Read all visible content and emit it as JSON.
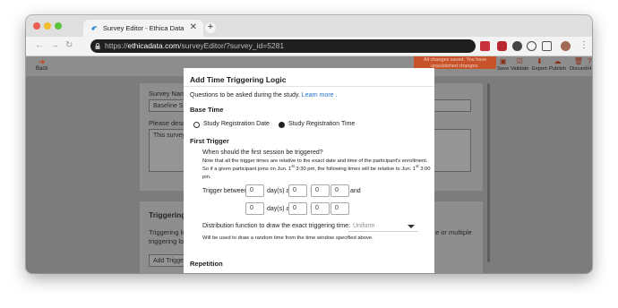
{
  "browser": {
    "tab_title": "Survey Editor - Ethica Data",
    "tab_close": "✕",
    "new_tab": "+",
    "url_prefix": "https://",
    "url_domain": "ethicadata.com",
    "url_path": "/surveyEditor/?survey_id=5281",
    "nav_back": "←",
    "nav_forward": "→",
    "nav_reload": "↻"
  },
  "toolbar": {
    "back_label": "Back",
    "notice_line1": "All changes saved. You have",
    "notice_line2": "unpublished changes.",
    "save_label": "Save",
    "validate_label": "Validate",
    "export_label": "Export",
    "publish_label": "Publish",
    "discard_label": "Discard",
    "help_label": "H"
  },
  "background": {
    "survey_name_label": "Survey Name",
    "survey_name_value": "Baseline S",
    "description_label": "Please descr",
    "description_value": "This survey",
    "triggering_title": "Triggering L",
    "triggering_text1": "Triggering lo",
    "triggering_text2": "triggering lo",
    "right_text": "e or multiple",
    "add_trigger_button": "Add Trigge"
  },
  "modal": {
    "title": "Add Time Triggering Logic",
    "intro_text": "Questions to be asked during the study.",
    "learn_more": "Learn more .",
    "base_time_heading": "Base Time",
    "option_registration_date": "Study Registration Date",
    "option_registration_time": "Study Registration Time",
    "first_trigger_heading": "First Trigger",
    "question": "When should the first session be triggered?",
    "note_line1": "Note that all the trigger times are relative to the exact date and time of the participant's enrollment.",
    "note_line2_a": "So if a given participant joins on Jun. 1",
    "note_sup": "st",
    "note_line2_b": " 3:30 pm, the following times will be relative to Jun. 1",
    "note_line2_c": " 3:00",
    "note_line3": "pm.",
    "trigger_between_label": "Trigger between",
    "days_at_label": "day(s) at",
    "and_label": "and",
    "colon": ":",
    "from": {
      "days": "0",
      "hours": "0",
      "minutes": "0",
      "seconds": "0"
    },
    "to": {
      "days": "0",
      "hours": "0",
      "minutes": "0",
      "seconds": "0"
    },
    "distribution_label": "Distribution function to draw the exact triggering time:",
    "distribution_value": "Uniform",
    "distribution_help": "Will be used to draw a random time from the time window specified above.",
    "repetition_heading": "Repetition"
  },
  "colors": {
    "accent": "#c8431e",
    "link": "#1f6fd1",
    "notice_bg": "#c7532b"
  }
}
